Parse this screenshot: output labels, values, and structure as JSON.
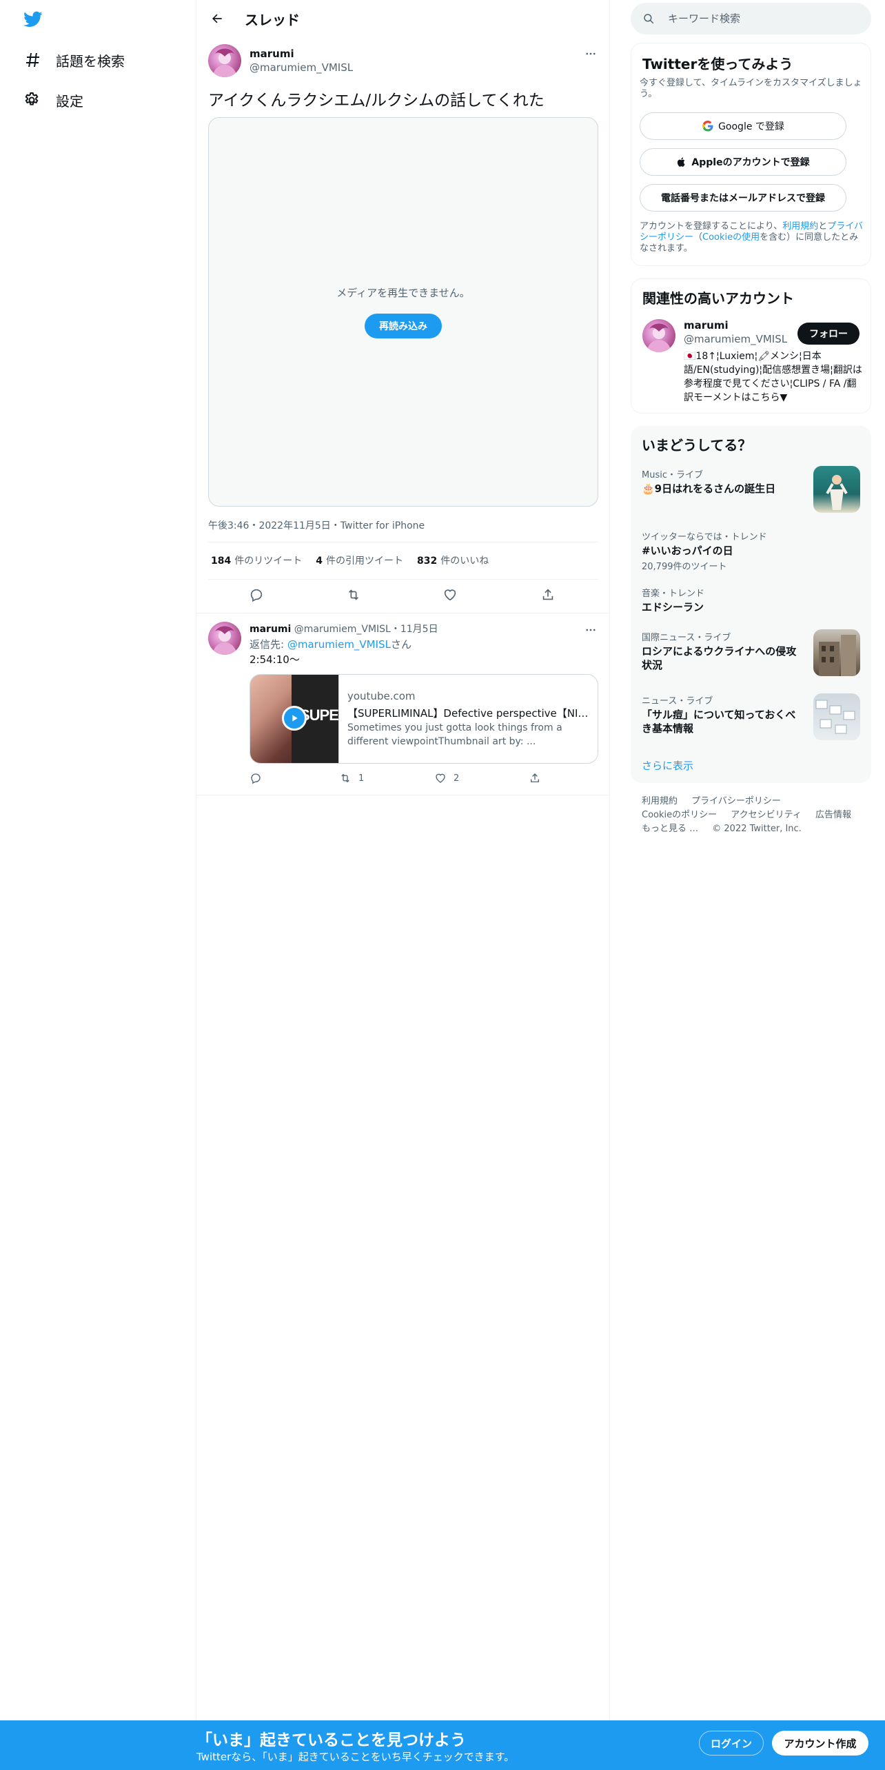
{
  "nav": {
    "logo": "twitter-bird-icon",
    "items": [
      {
        "label": "話題を検索",
        "icon": "hashtag-icon"
      },
      {
        "label": "設定",
        "icon": "gear-icon"
      }
    ]
  },
  "header": {
    "title": "スレッド"
  },
  "tweet": {
    "name": "marumi",
    "handle": "@marumiem_VMISL",
    "text": "アイクくんラクシエム/ルクシムの話してくれた",
    "media_message": "メディアを再生できません。",
    "media_reload": "再読み込み",
    "meta": "午後3:46・2022年11月5日・Twitter for iPhone",
    "stats": [
      {
        "count": "184",
        "label": "件のリツイート"
      },
      {
        "count": "4",
        "label": "件の引用ツイート"
      },
      {
        "count": "832",
        "label": "件のいいね"
      }
    ]
  },
  "reply": {
    "name": "marumi",
    "handle_date": "@marumiem_VMISL・11月5日",
    "reply_to_prefix": "返信先: ",
    "reply_to_handle": "@marumiem_VMISL",
    "reply_to_suffix": "さん",
    "text": "2:54:10〜",
    "card": {
      "thumb_text": "SUPERLI",
      "domain": "youtube.com",
      "title": "【SUPERLIMINAL】Defective perspective【NIJISANJI EN | Ike Eveland】",
      "description": "Sometimes you just gotta look things from a different viewpointThumbnail art by: ..."
    },
    "retweets": "1",
    "likes": "2"
  },
  "search": {
    "placeholder": "キーワード検索"
  },
  "signup": {
    "title": "Twitterを使ってみよう",
    "subtitle": "今すぐ登録して、タイムラインをカスタマイズしましょう。",
    "google": "Google で登録",
    "apple": "Appleのアカウントで登録",
    "phone": "電話番号またはメールアドレスで登録",
    "legal_prefix": "アカウントを登録することにより、",
    "legal_terms": "利用規約",
    "legal_and": "と",
    "legal_privacy": "プライバシーポリシー",
    "legal_open": "（",
    "legal_cookie": "Cookieの使用",
    "legal_suffix": "を含む）に同意したとみなされます。"
  },
  "relevant": {
    "title": "関連性の高いアカウント",
    "name": "marumi",
    "handle": "@marumiem_VMISL",
    "follow": "フォロー",
    "bio": "🇯🇵18↑¦Luxiem¦🖍メンシ¦日本語/EN(studying)¦配信感想置き場¦翻訳は参考程度で見てください¦CLIPS / FA /翻訳モーメントはこちら▼"
  },
  "trends": {
    "title": "いまどうしてる？",
    "items": [
      {
        "meta": "Music・ライブ",
        "name": "🎂9日はれをるさんの誕生日",
        "count": ""
      },
      {
        "meta": "ツイッターならでは・トレンド",
        "name": "#いいおっパイの日",
        "count": "20,799件のツイート"
      },
      {
        "meta": "音楽・トレンド",
        "name": "エドシーラン",
        "count": ""
      },
      {
        "meta": "国際ニュース・ライブ",
        "name": "ロシアによるウクライナへの侵攻状況",
        "count": ""
      },
      {
        "meta": "ニュース・ライブ",
        "name": "「サル痘」について知っておくべき基本情報",
        "count": ""
      }
    ],
    "more": "さらに表示"
  },
  "footer": {
    "links": [
      "利用規約",
      "プライバシーポリシー",
      "Cookieのポリシー",
      "アクセシビリティ",
      "広告情報",
      "もっと見る …",
      "© 2022 Twitter, Inc."
    ]
  },
  "bottom": {
    "headline": "「いま」起きていることを見つけよう",
    "sub": "Twitterなら、「いま」起きていることをいち早くチェックできます。",
    "login": "ログイン",
    "signup": "アカウント作成"
  },
  "colors": {
    "accent": "#1d9bf0",
    "text": "#0f1419",
    "secondary": "#536471"
  }
}
